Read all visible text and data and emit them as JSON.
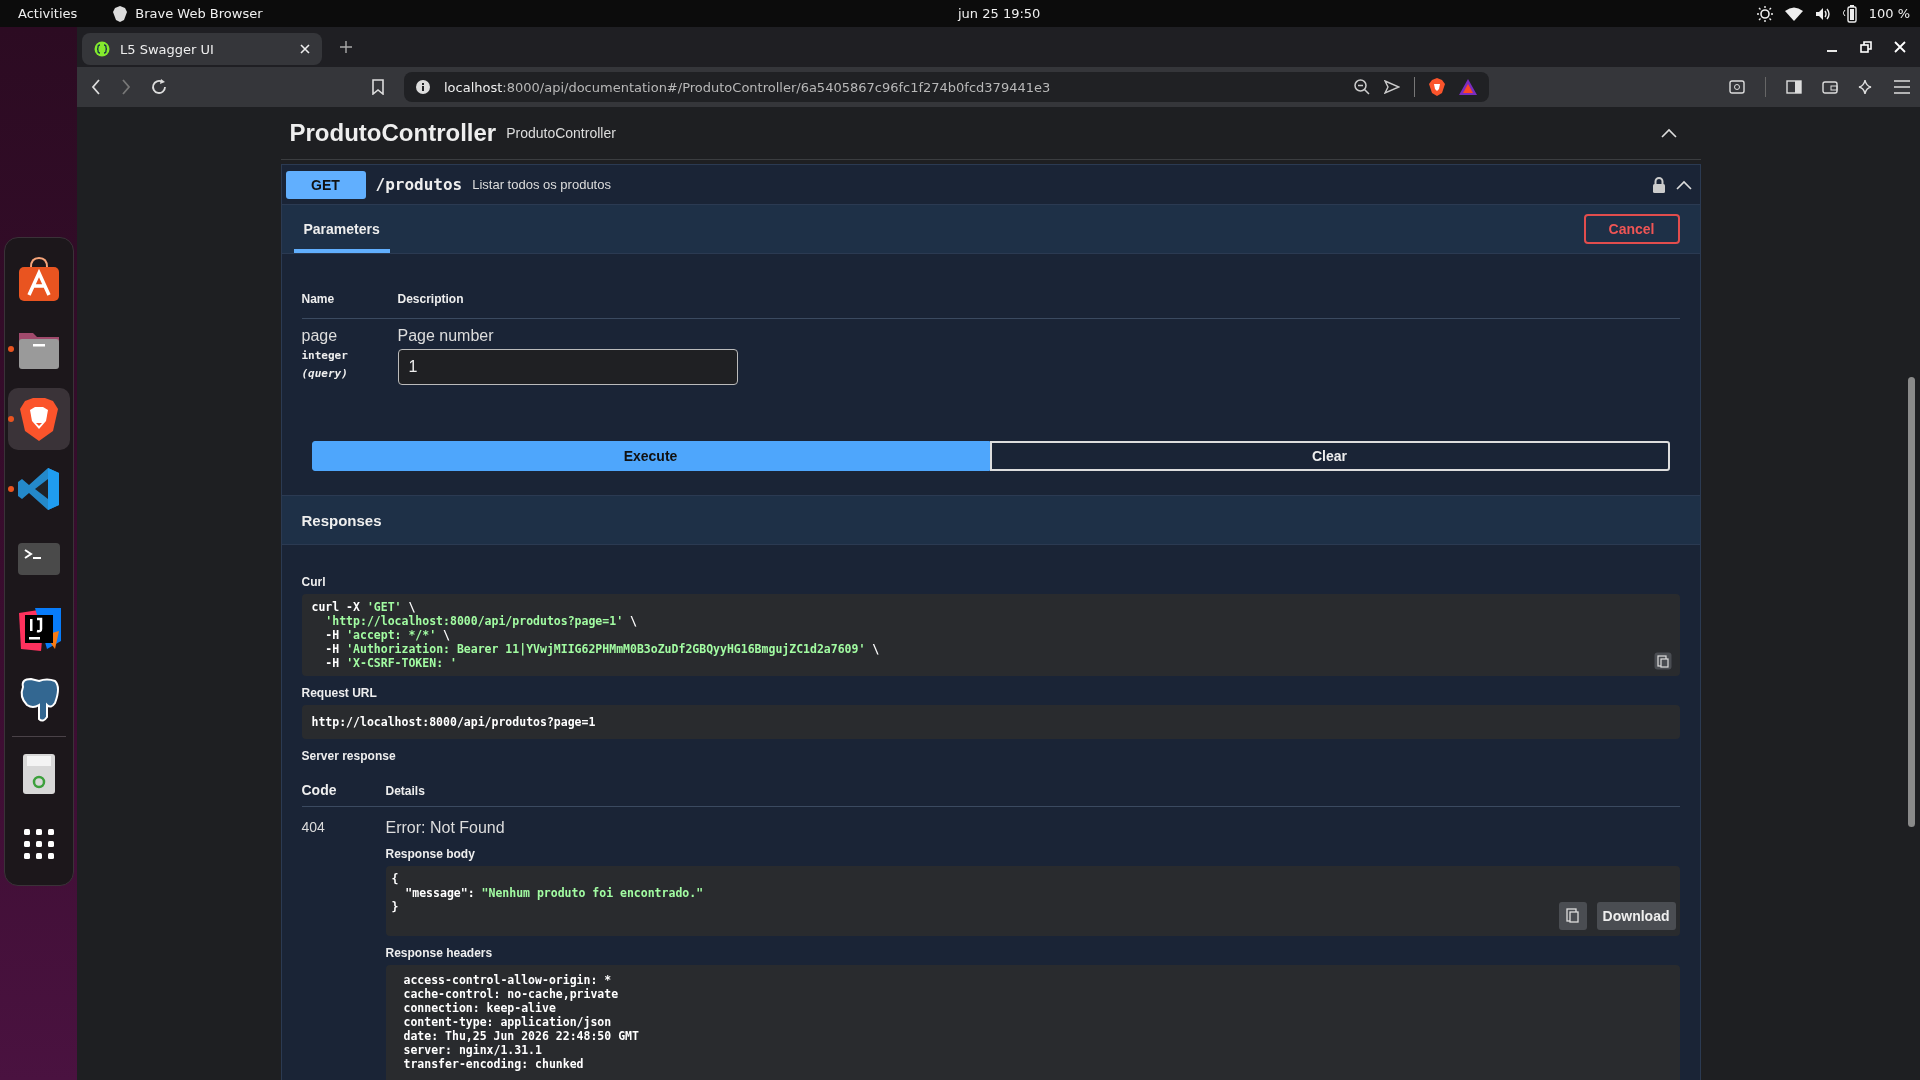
{
  "top_bar": {
    "activities": "Activities",
    "app": "Brave Web Browser",
    "clock": "jun 25  19:50",
    "battery": "100 %"
  },
  "dock": {
    "items": [
      {
        "kind": "store",
        "running": false,
        "selected": false
      },
      {
        "kind": "files",
        "running": true,
        "selected": false
      },
      {
        "kind": "brave",
        "running": true,
        "selected": true
      },
      {
        "kind": "vscode",
        "running": true,
        "selected": false
      },
      {
        "kind": "terminal",
        "running": false,
        "selected": false
      },
      {
        "kind": "intellij",
        "running": false,
        "selected": false
      },
      {
        "kind": "postgres",
        "running": false,
        "selected": false
      },
      {
        "kind": "trash",
        "running": false,
        "selected": false
      },
      {
        "kind": "apps",
        "running": false,
        "selected": false
      }
    ]
  },
  "browser": {
    "tabs": [
      {
        "title": "L5 Swagger UI",
        "selected": true
      }
    ],
    "url": {
      "host": "localhost",
      "rest": ":8000/api/documentation#/ProdutoController/6a5405867c96fc1f274b0fcd379441e3"
    }
  },
  "controller": {
    "title": "ProdutoController",
    "description": "ProdutoController",
    "expanded": true
  },
  "operation": {
    "method": "GET",
    "path": "/produtos",
    "summary": "Listar todos os produtos",
    "expanded": true,
    "parameters": {
      "tab": "Parameters",
      "cancel": "Cancel",
      "columns": [
        "Name",
        "Description"
      ],
      "rows": [
        {
          "name": "page",
          "type": "integer",
          "location": "(query)",
          "description": "Page number",
          "value": "1"
        }
      ],
      "execute": "Execute",
      "clear": "Clear"
    },
    "responses": {
      "title": "Responses",
      "curl": {
        "label": "Curl",
        "lines": [
          [
            {
              "text": "curl -X ",
              "kind": "plain"
            },
            {
              "text": "'GET'",
              "kind": "string"
            },
            {
              "text": " \\",
              "kind": "plain"
            }
          ],
          [
            {
              "text": "  'http://localhost:8000/api/produtos?page=1'",
              "kind": "string"
            },
            {
              "text": " \\",
              "kind": "plain"
            }
          ],
          [
            {
              "text": "  -H ",
              "kind": "plain"
            },
            {
              "text": "'accept: */*'",
              "kind": "string"
            },
            {
              "text": " \\",
              "kind": "plain"
            }
          ],
          [
            {
              "text": "  -H ",
              "kind": "plain"
            },
            {
              "text": "'Authorization: Bearer 11|YVwjMIIG62PHMmM0B3oZuDf2GBQyyHG16BmgujZC1d2a7609'",
              "kind": "string"
            },
            {
              "text": " \\",
              "kind": "plain"
            }
          ],
          [
            {
              "text": "  -H ",
              "kind": "plain"
            },
            {
              "text": "'X-CSRF-TOKEN: '",
              "kind": "string"
            }
          ]
        ]
      },
      "request_url": {
        "label": "Request URL",
        "value": "http://localhost:8000/api/produtos?page=1"
      },
      "server_response": {
        "label": "Server response",
        "columns": [
          "Code",
          "Details"
        ],
        "code": "404",
        "status": "Error: Not Found",
        "body": {
          "label": "Response body",
          "lines": [
            [
              {
                "text": "{",
                "kind": "plain"
              }
            ],
            [
              {
                "text": "  \"message\"",
                "kind": "key"
              },
              {
                "text": ": ",
                "kind": "plain"
              },
              {
                "text": "\"Nenhum produto foi encontrado.\"",
                "kind": "string"
              }
            ],
            [
              {
                "text": "}",
                "kind": "plain"
              }
            ]
          ],
          "download": "Download"
        },
        "headers": {
          "label": "Response headers",
          "lines": [
            "access-control-allow-origin: *",
            "cache-control: no-cache,private",
            "connection: keep-alive",
            "content-type: application/json",
            "date: Thu,25 Jun 2026 22:48:50 GMT",
            "server: nginx/1.31.1",
            "transfer-encoding: chunked"
          ]
        }
      }
    }
  }
}
